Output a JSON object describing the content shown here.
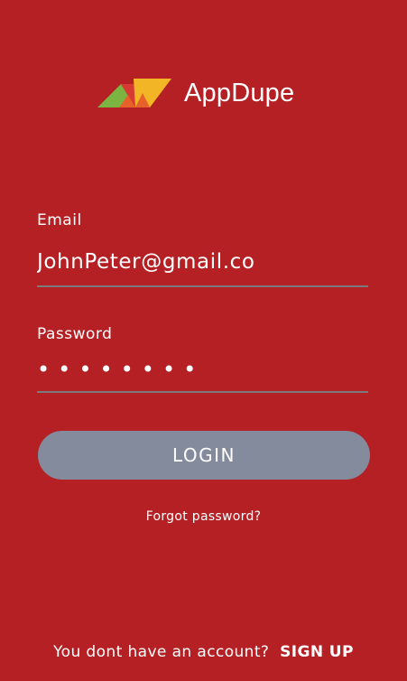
{
  "logo": {
    "text": "AppDupe",
    "colors": {
      "green": "#7bb441",
      "yellow": "#f2b526",
      "orange": "#e8602a",
      "red": "#d63a32"
    }
  },
  "form": {
    "email_label": "Email",
    "email_value": "JohnPeter@gmail.co",
    "password_label": "Password",
    "password_value": "password"
  },
  "buttons": {
    "login_label": "LOGIN"
  },
  "links": {
    "forgot_password": "Forgot password?",
    "signup_prompt": "You dont have an account?",
    "signup_label": "SIGN UP"
  },
  "colors": {
    "background": "#b42024",
    "button": "#838b9c",
    "underline": "#7a7a7f",
    "text": "#ffffff"
  }
}
